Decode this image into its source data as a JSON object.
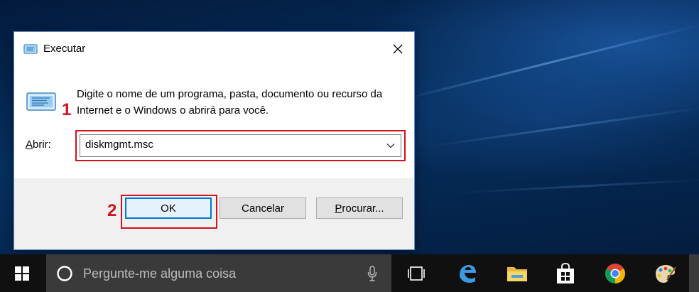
{
  "window": {
    "title": "Executar",
    "description": "Digite o nome de um programa, pasta, documento ou recurso da Internet e o Windows o abrirá para você.",
    "open_label_access": "A",
    "open_label_rest": "brir:",
    "open_value": "diskmgmt.msc"
  },
  "buttons": {
    "ok": "OK",
    "cancel": "Cancelar",
    "browse_access": "P",
    "browse_rest": "rocurar..."
  },
  "annotations": {
    "step1": "1",
    "step2": "2",
    "highlight_color": "#d3111b"
  },
  "taskbar": {
    "search_placeholder": "Pergunte-me alguma coisa",
    "icons": [
      "windows-start-icon",
      "cortana-icon",
      "microphone-icon",
      "task-view-icon",
      "edge-icon",
      "file-explorer-icon",
      "store-icon",
      "chrome-icon",
      "paint-icon"
    ]
  },
  "colors": {
    "accent": "#0078d7",
    "taskbar": "#101010",
    "search_box": "#3a3a3a"
  }
}
